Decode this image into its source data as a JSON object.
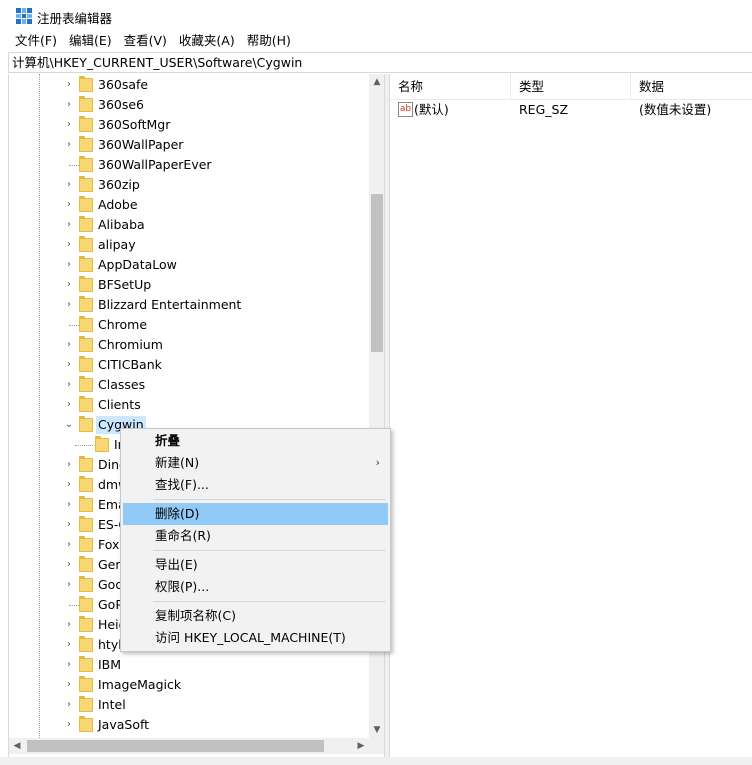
{
  "window": {
    "title": "注册表编辑器"
  },
  "menu": [
    "文件(F)",
    "编辑(E)",
    "查看(V)",
    "收藏夹(A)",
    "帮助(H)"
  ],
  "address": "计算机\\HKEY_CURRENT_USER\\Software\\Cygwin",
  "tree": {
    "items": [
      {
        "label": "360safe",
        "state": "collapsed"
      },
      {
        "label": "360se6",
        "state": "collapsed"
      },
      {
        "label": "360SoftMgr",
        "state": "collapsed"
      },
      {
        "label": "360WallPaper",
        "state": "collapsed"
      },
      {
        "label": "360WallPaperEver",
        "state": "leaf"
      },
      {
        "label": "360zip",
        "state": "collapsed"
      },
      {
        "label": "Adobe",
        "state": "collapsed"
      },
      {
        "label": "Alibaba",
        "state": "collapsed"
      },
      {
        "label": "alipay",
        "state": "collapsed"
      },
      {
        "label": "AppDataLow",
        "state": "collapsed"
      },
      {
        "label": "BFSetUp",
        "state": "collapsed"
      },
      {
        "label": "Blizzard Entertainment",
        "state": "collapsed"
      },
      {
        "label": "Chrome",
        "state": "leaf"
      },
      {
        "label": "Chromium",
        "state": "collapsed"
      },
      {
        "label": "CITICBank",
        "state": "collapsed"
      },
      {
        "label": "Classes",
        "state": "collapsed"
      },
      {
        "label": "Clients",
        "state": "collapsed"
      },
      {
        "label": "Cygwin",
        "state": "expanded",
        "selected": true
      },
      {
        "label": "In",
        "state": "child"
      },
      {
        "label": "Ding",
        "state": "collapsed"
      },
      {
        "label": "dmw",
        "state": "collapsed"
      },
      {
        "label": "Ema",
        "state": "collapsed"
      },
      {
        "label": "ES-C",
        "state": "collapsed"
      },
      {
        "label": "Foxi",
        "state": "collapsed"
      },
      {
        "label": "Gen",
        "state": "collapsed"
      },
      {
        "label": "Goo",
        "state": "collapsed"
      },
      {
        "label": "GoP",
        "state": "leaf"
      },
      {
        "label": "Heid",
        "state": "collapsed"
      },
      {
        "label": "htyh",
        "state": "collapsed"
      },
      {
        "label": "IBM",
        "state": "collapsed"
      },
      {
        "label": "ImageMagick",
        "state": "collapsed"
      },
      {
        "label": "Intel",
        "state": "collapsed"
      },
      {
        "label": "JavaSoft",
        "state": "collapsed"
      }
    ]
  },
  "list": {
    "columns": [
      "名称",
      "类型",
      "数据"
    ],
    "rows": [
      {
        "name": "(默认)",
        "type": "REG_SZ",
        "data": "(数值未设置)",
        "icon": "string-value-icon",
        "icon_text": "ab"
      }
    ]
  },
  "context_menu": {
    "items": [
      {
        "label": "折叠",
        "bold": true
      },
      {
        "label": "新建(N)",
        "submenu": true,
        "arrow": "›"
      },
      {
        "label": "查找(F)..."
      },
      {
        "separator": true
      },
      {
        "label": "删除(D)",
        "highlight": true
      },
      {
        "label": "重命名(R)"
      },
      {
        "separator": true
      },
      {
        "label": "导出(E)"
      },
      {
        "label": "权限(P)..."
      },
      {
        "separator": true
      },
      {
        "label": "复制项名称(C)"
      },
      {
        "label": "访问 HKEY_LOCAL_MACHINE(T)"
      }
    ]
  },
  "scroll": {
    "up": "▲",
    "down": "▼",
    "left": "◀",
    "right": "▶",
    "collapsed_arrow": "›",
    "expanded_arrow": "⌄"
  },
  "colors": {
    "selection": "#cce8ff",
    "menu_highlight": "#91c9f7",
    "folder": "#f8d775"
  }
}
